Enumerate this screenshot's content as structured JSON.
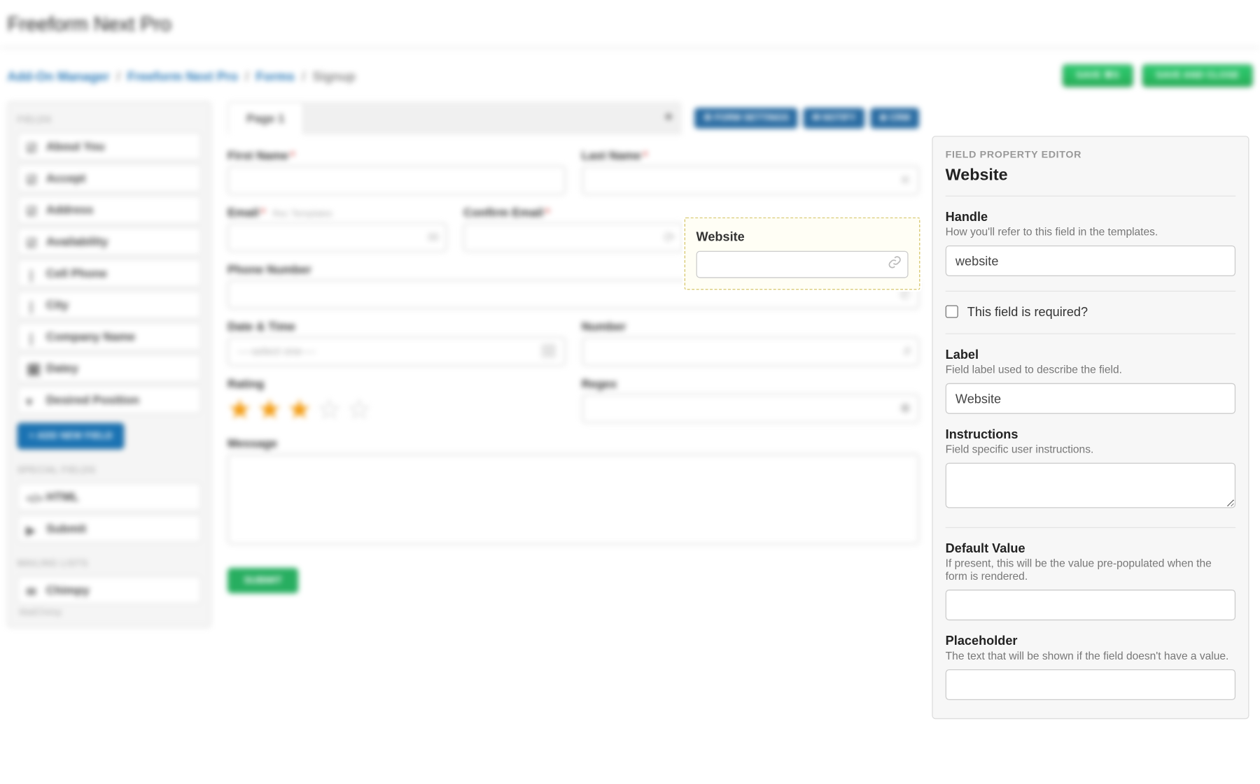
{
  "app_title": "Freeform Next Pro",
  "breadcrumb": {
    "addon_manager": "Add-On Manager",
    "product": "Freeform Next Pro",
    "forms": "Forms",
    "current": "Signup"
  },
  "buttons": {
    "save": "SAVE ⌘S",
    "save_close": "SAVE AND CLOSE"
  },
  "sidebar": {
    "heads": {
      "fields": "FIELDS",
      "special": "SPECIAL FIELDS",
      "mailing": "MAILING LISTS"
    },
    "items": [
      {
        "label": "About You"
      },
      {
        "label": "Accept"
      },
      {
        "label": "Address"
      },
      {
        "label": "Availability"
      },
      {
        "label": "Cell Phone"
      },
      {
        "label": "City"
      },
      {
        "label": "Company Name"
      },
      {
        "label": "Datey"
      },
      {
        "label": "Desired Position"
      }
    ],
    "add_field": "+ ADD NEW FIELD",
    "special": [
      {
        "label": "HTML"
      },
      {
        "label": "Submit"
      }
    ],
    "mailing": {
      "name": "Chimpy",
      "sub": "MailChimp"
    }
  },
  "canvas": {
    "tab": "Page 1",
    "pills": {
      "form_settings": "⚙ FORM SETTINGS",
      "notify": "✉ NOTIFY",
      "crm": "⊕ CRM"
    },
    "fields": {
      "first_name": "First Name",
      "last_name": "Last Name",
      "email": "Email",
      "email_meta": "Rec Templates",
      "confirm_email": "Confirm Email",
      "phone": "Phone Number",
      "datetime": "Date & Time",
      "datetime_ph": "----select one----",
      "number": "Number",
      "rating": "Rating",
      "regex": "Regex",
      "message": "Message",
      "submit": "SUBMIT"
    }
  },
  "focus": {
    "label": "Website"
  },
  "editor": {
    "head": "FIELD PROPERTY EDITOR",
    "title": "Website",
    "handle": {
      "label": "Handle",
      "help": "How you'll refer to this field in the templates.",
      "value": "website"
    },
    "required_label": "This field is required?",
    "label": {
      "label": "Label",
      "help": "Field label used to describe the field.",
      "value": "Website"
    },
    "instructions": {
      "label": "Instructions",
      "help": "Field specific user instructions.",
      "value": ""
    },
    "default": {
      "label": "Default Value",
      "help": "If present, this will be the value pre-populated when the form is rendered.",
      "value": ""
    },
    "placeholder": {
      "label": "Placeholder",
      "help": "The text that will be shown if the field doesn't have a value.",
      "value": ""
    }
  }
}
